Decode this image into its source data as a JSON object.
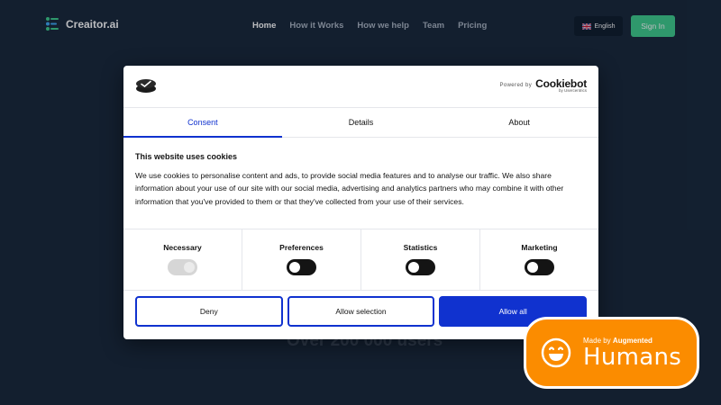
{
  "site": {
    "brand": "Creaitor.ai",
    "nav": [
      {
        "label": "Home",
        "active": true
      },
      {
        "label": "How it Works",
        "active": false
      },
      {
        "label": "How we help",
        "active": false
      },
      {
        "label": "Team",
        "active": false
      },
      {
        "label": "Pricing",
        "active": false
      }
    ],
    "language": "English",
    "sign_in": "Sign In",
    "hero_users": "Over 200 000 users"
  },
  "dialog": {
    "powered_by": "Powered by",
    "cookiebot_name": "Cookiebot",
    "cookiebot_sub": "by Usercentrics",
    "tabs": [
      "Consent",
      "Details",
      "About"
    ],
    "active_tab": "Consent",
    "title": "This website uses cookies",
    "body": "We use cookies to personalise content and ads, to provide social media features and to analyse our traffic. We also share information about your use of our site with our social media, advertising and analytics partners who may combine it with other information that you've provided to them or that they've collected from your use of their services.",
    "toggles": [
      {
        "label": "Necessary",
        "on": true,
        "disabled": true
      },
      {
        "label": "Preferences",
        "on": false,
        "disabled": false
      },
      {
        "label": "Statistics",
        "on": false,
        "disabled": false
      },
      {
        "label": "Marketing",
        "on": false,
        "disabled": false
      }
    ],
    "buttons": {
      "deny": "Deny",
      "allow_selection": "Allow selection",
      "allow_all": "Allow all"
    }
  },
  "badge": {
    "made_by": "Made by",
    "augmented": "Augmented",
    "humans": "Humans"
  },
  "colors": {
    "background": "#18283a",
    "accent": "#1032cf",
    "sign_in": "#3fcf8e",
    "badge": "#fb8c00"
  }
}
